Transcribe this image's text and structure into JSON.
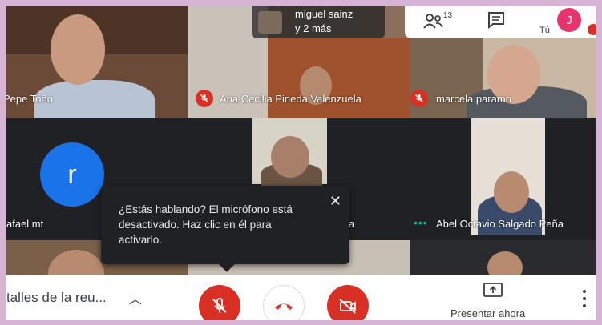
{
  "topbar": {
    "presenter_name": "miguel sainz",
    "presenter_more": "y 2 más",
    "participant_count": "13",
    "you_label": "Tú",
    "avatar_initial": "J",
    "people_icon": "people-icon",
    "chat_icon": "chat-icon"
  },
  "tiles": {
    "pepe": "Pepe Toño",
    "ana": "Ana Cecilia Pineda Valenzuela",
    "marcela": "marcela paramo",
    "rafael": "afael mt",
    "rafael_initial": "r",
    "middle_suffix": "ia",
    "abel": "Abel Octavio Salgado Peña"
  },
  "tooltip": {
    "text": "¿Estás hablando? El micrófono está desactivado. Haz clic en él para activarlo."
  },
  "bottombar": {
    "meeting_details": "talles de la reu...",
    "present_label": "Presentar ahora"
  },
  "colors": {
    "red": "#d93025",
    "blue": "#1a73e8",
    "avatar_pink": "#e8336f"
  }
}
